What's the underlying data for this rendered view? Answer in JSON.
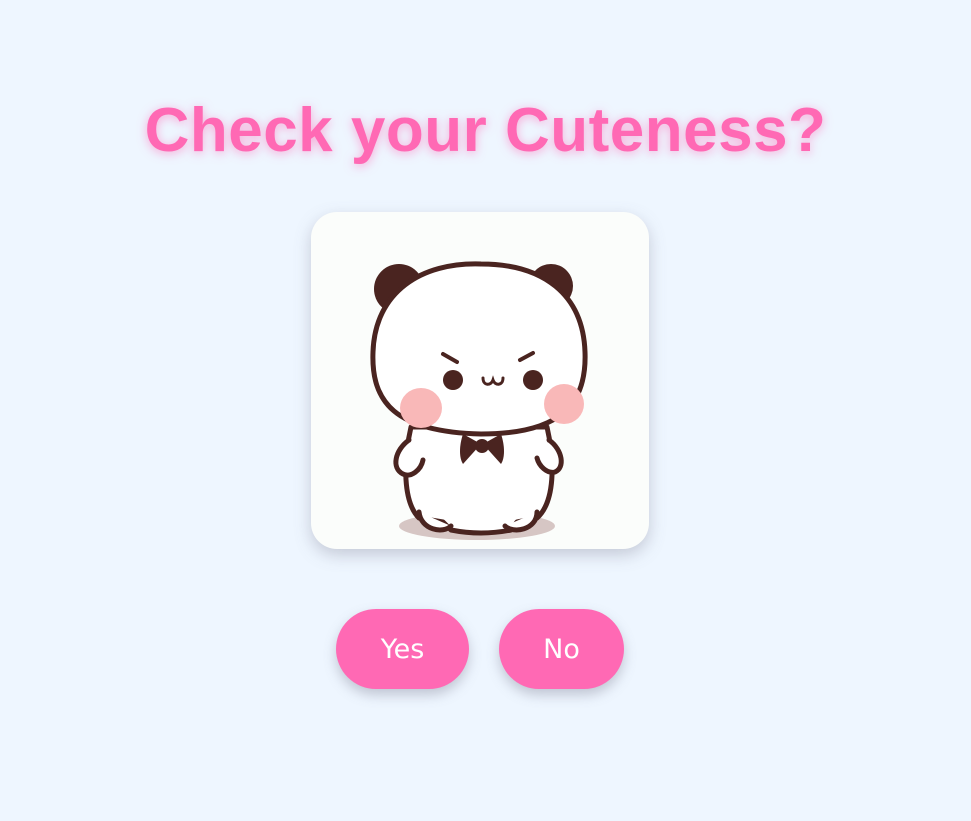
{
  "page": {
    "title": "Check your Cuteness?"
  },
  "image": {
    "icon": "panda-bear-icon"
  },
  "buttons": {
    "yes_label": "Yes",
    "no_label": "No"
  },
  "colors": {
    "background": "#eef6ff",
    "accent": "#ff69b4",
    "card": "#fbfdfb",
    "panda_outline": "#4a2420",
    "blush": "#f9b8b8"
  }
}
